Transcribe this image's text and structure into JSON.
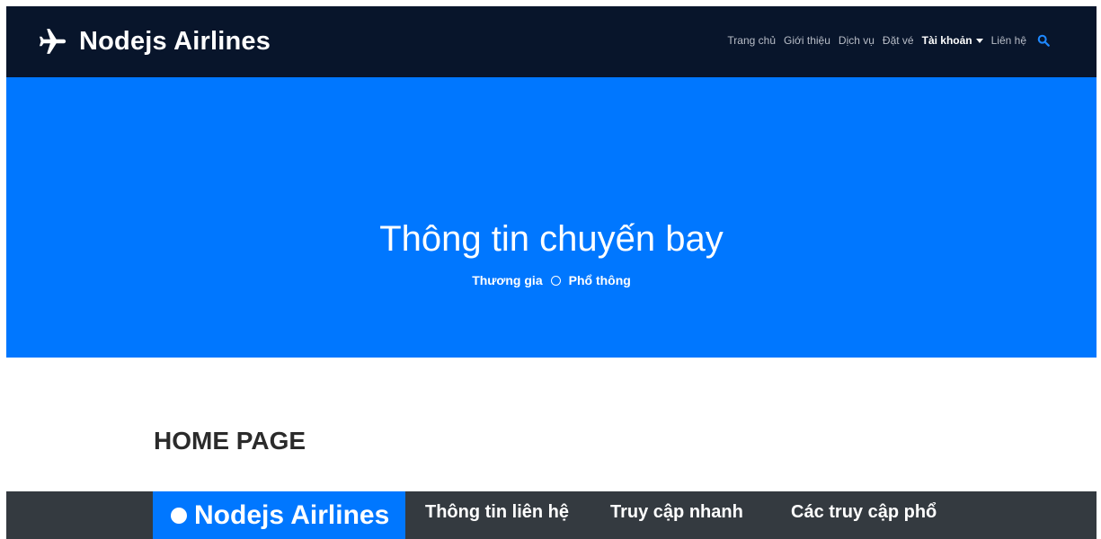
{
  "navbar": {
    "brand": "Nodejs Airlines",
    "brand_icon": "airplane-icon",
    "items": [
      {
        "label": "Trang chủ",
        "active": false
      },
      {
        "label": "Giới thiệu",
        "active": false
      },
      {
        "label": "Dịch vụ",
        "active": false
      },
      {
        "label": "Đặt vé",
        "active": false
      },
      {
        "label": "Tài khoản",
        "active": true
      },
      {
        "label": "Liên hệ",
        "active": false
      }
    ],
    "search_icon": "search-icon",
    "accent_color": "#0077ff",
    "background_color": "#08152b"
  },
  "hero": {
    "title": "Thông tin chuyến bay",
    "link_business": "Thương gia",
    "link_economy": "Phổ thông",
    "background_color": "#0077ff"
  },
  "main": {
    "heading": "HOME PAGE"
  },
  "footer": {
    "brand": "Nodejs Airlines",
    "col1_title": "Thông tin liên hệ",
    "col2_title": "Truy cập nhanh",
    "col3_title": "Các truy cập phổ",
    "background_color": "#343a40"
  }
}
